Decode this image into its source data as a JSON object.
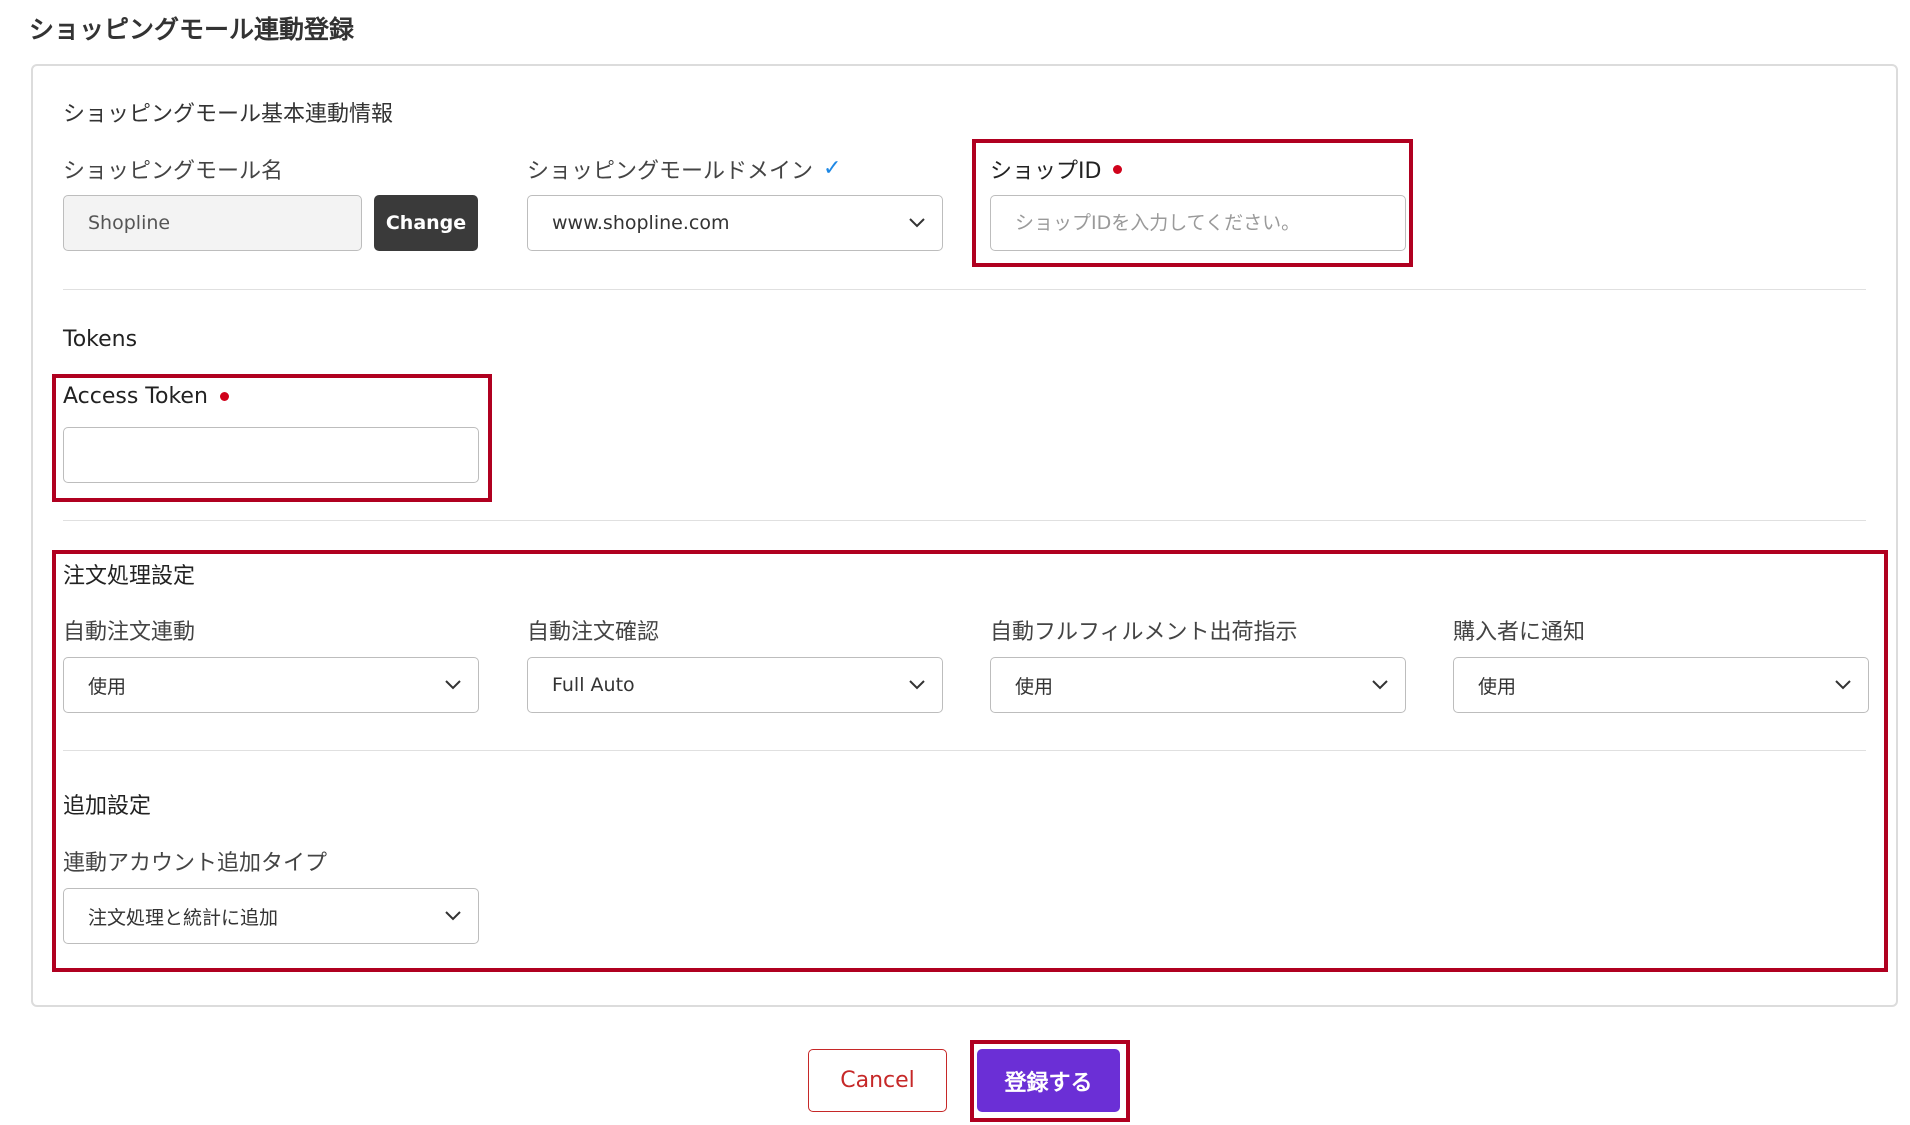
{
  "page": {
    "title": "ショッピングモール連動登録"
  },
  "basic": {
    "section_title": "ショッピングモール基本連動情報",
    "mall_name_label": "ショッピングモール名",
    "mall_name_value": "Shopline",
    "change_label": "Change",
    "domain_label": "ショッピングモールドメイン",
    "domain_value": "www.shopline.com",
    "shop_id_label": "ショップID",
    "shop_id_placeholder": "ショップIDを入力してください。"
  },
  "tokens": {
    "section_title": "Tokens",
    "access_token_label": "Access Token",
    "access_token_value": ""
  },
  "order": {
    "section_title": "注文処理設定",
    "fields": [
      {
        "label": "自動注文連動",
        "value": "使用"
      },
      {
        "label": "自動注文確認",
        "value": "Full Auto"
      },
      {
        "label": "自動フルフィルメント出荷指示",
        "value": "使用"
      },
      {
        "label": "購入者に通知",
        "value": "使用"
      }
    ]
  },
  "additional": {
    "section_title": "追加設定",
    "account_type_label": "連動アカウント追加タイプ",
    "account_type_value": "注文処理と統計に追加"
  },
  "actions": {
    "cancel_label": "Cancel",
    "submit_label": "登録する"
  },
  "colors": {
    "required_dot": "#d0021b",
    "verified_check": "#1e88e5",
    "highlight_border": "#b00020",
    "submit_bg": "#6b2fd6",
    "cancel_text": "#c62828",
    "change_bg": "#3a3a3a"
  }
}
